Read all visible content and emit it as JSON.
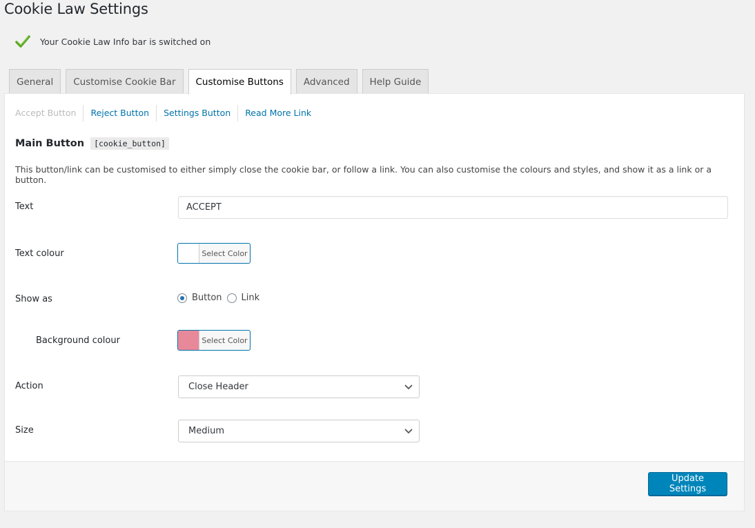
{
  "page": {
    "title": "Cookie Law Settings"
  },
  "notice": {
    "text": "Your Cookie Law Info bar is switched on"
  },
  "tabs": [
    {
      "label": "General"
    },
    {
      "label": "Customise Cookie Bar"
    },
    {
      "label": "Customise Buttons",
      "active": true
    },
    {
      "label": "Advanced"
    },
    {
      "label": "Help Guide"
    }
  ],
  "subtabs": [
    {
      "label": "Accept Button",
      "current": true
    },
    {
      "label": "Reject Button"
    },
    {
      "label": "Settings Button"
    },
    {
      "label": "Read More Link"
    }
  ],
  "section": {
    "title": "Main Button",
    "shortcode": "[cookie_button]",
    "description": "This button/link can be customised to either simply close the cookie bar, or follow a link. You can also customise the colours and styles, and show it as a link or a button."
  },
  "fields": {
    "text": {
      "label": "Text",
      "value": "ACCEPT"
    },
    "text_colour": {
      "label": "Text colour",
      "button_label": "Select Color",
      "color": "#ffffff"
    },
    "show_as": {
      "label": "Show as",
      "options": [
        "Button",
        "Link"
      ],
      "selected": "Button"
    },
    "background_colour": {
      "label": "Background colour",
      "button_label": "Select Color",
      "color": "#e8899a"
    },
    "action": {
      "label": "Action",
      "value": "Close Header"
    },
    "size": {
      "label": "Size",
      "value": "Medium"
    }
  },
  "footer": {
    "update_label": "Update Settings"
  },
  "colors": {
    "accent": "#0073aa",
    "button_primary": "#0085ba",
    "check_green": "#5aa624"
  }
}
